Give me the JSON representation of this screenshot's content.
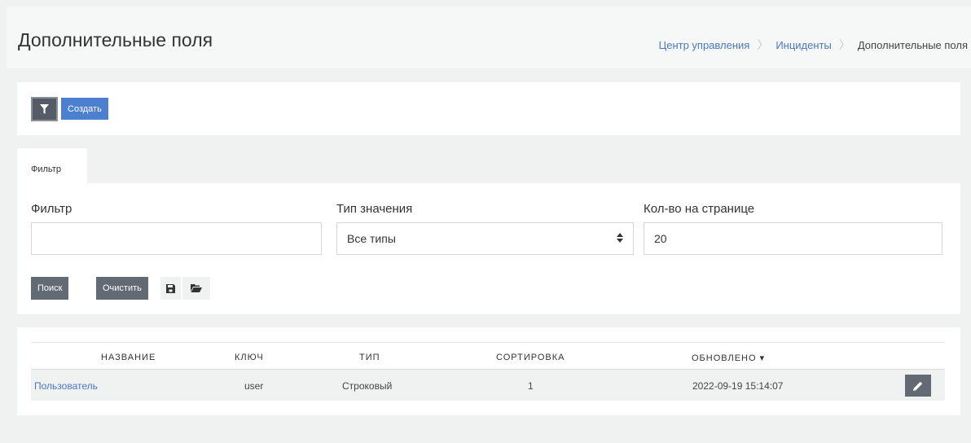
{
  "header": {
    "title": "Дополнительные поля",
    "breadcrumb": [
      {
        "label": "Центр управления",
        "link": true
      },
      {
        "label": "Инциденты",
        "link": true
      },
      {
        "label": "Дополнительные поля",
        "link": false
      }
    ]
  },
  "actions": {
    "filter_icon": "filter-icon",
    "create_label": "Создать"
  },
  "filter": {
    "tab_label": "Фильтр",
    "filter_label": "Фильтр",
    "filter_value": "",
    "type_label": "Тип значения",
    "type_value": "Все типы",
    "per_page_label": "Кол-во на странице",
    "per_page_value": "20",
    "search_label": "Поиск",
    "clear_label": "Очистить",
    "save_icon": "save-icon",
    "folder_icon": "folder-open-icon"
  },
  "table": {
    "columns": [
      "НАЗВАНИЕ",
      "КЛЮЧ",
      "ТИП",
      "СОРТИРОВКА",
      "ОБНОВЛЕНО ▾"
    ],
    "rows": [
      {
        "name": "Пользователь",
        "key": "user",
        "type": "Строковый",
        "sort": "1",
        "updated": "2022-09-19 15:14:07"
      }
    ],
    "edit_icon": "pencil-icon"
  },
  "colors": {
    "accent": "#4d7fd1",
    "link": "#4a78c6",
    "dark_button": "#626a74"
  }
}
